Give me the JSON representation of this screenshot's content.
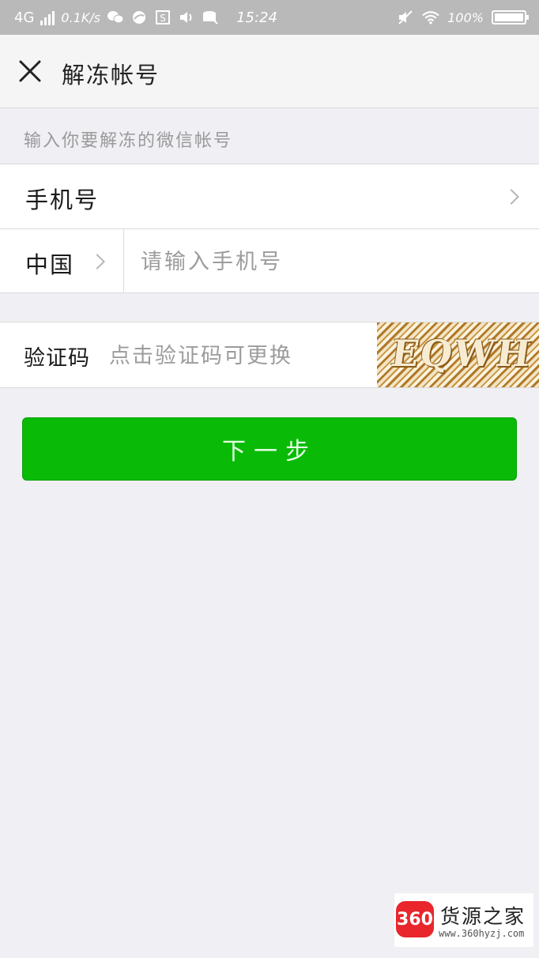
{
  "status_bar": {
    "network": "4G",
    "speed": "0.1K/s",
    "time": "15:24",
    "battery": "100%",
    "battery_level": 1.0
  },
  "navbar": {
    "title": "解冻帐号"
  },
  "form": {
    "hint": "输入你要解冻的微信帐号",
    "phone_row_label": "手机号",
    "country": "中国",
    "phone_placeholder": "请输入手机号",
    "captcha_label": "验证码",
    "captcha_placeholder": "点击验证码可更换",
    "captcha_text": "EQWH"
  },
  "actions": {
    "next_label": "下一步"
  },
  "watermark": {
    "logo": "360",
    "name": "货源之家",
    "url": "www.360hyzj.com"
  },
  "colors": {
    "primary_button": "#09bb07",
    "page_background": "#efeff4",
    "statusbar": "#b9b9b9"
  },
  "icons": {
    "close": "close-icon",
    "chevron": "chevron-right-icon"
  }
}
